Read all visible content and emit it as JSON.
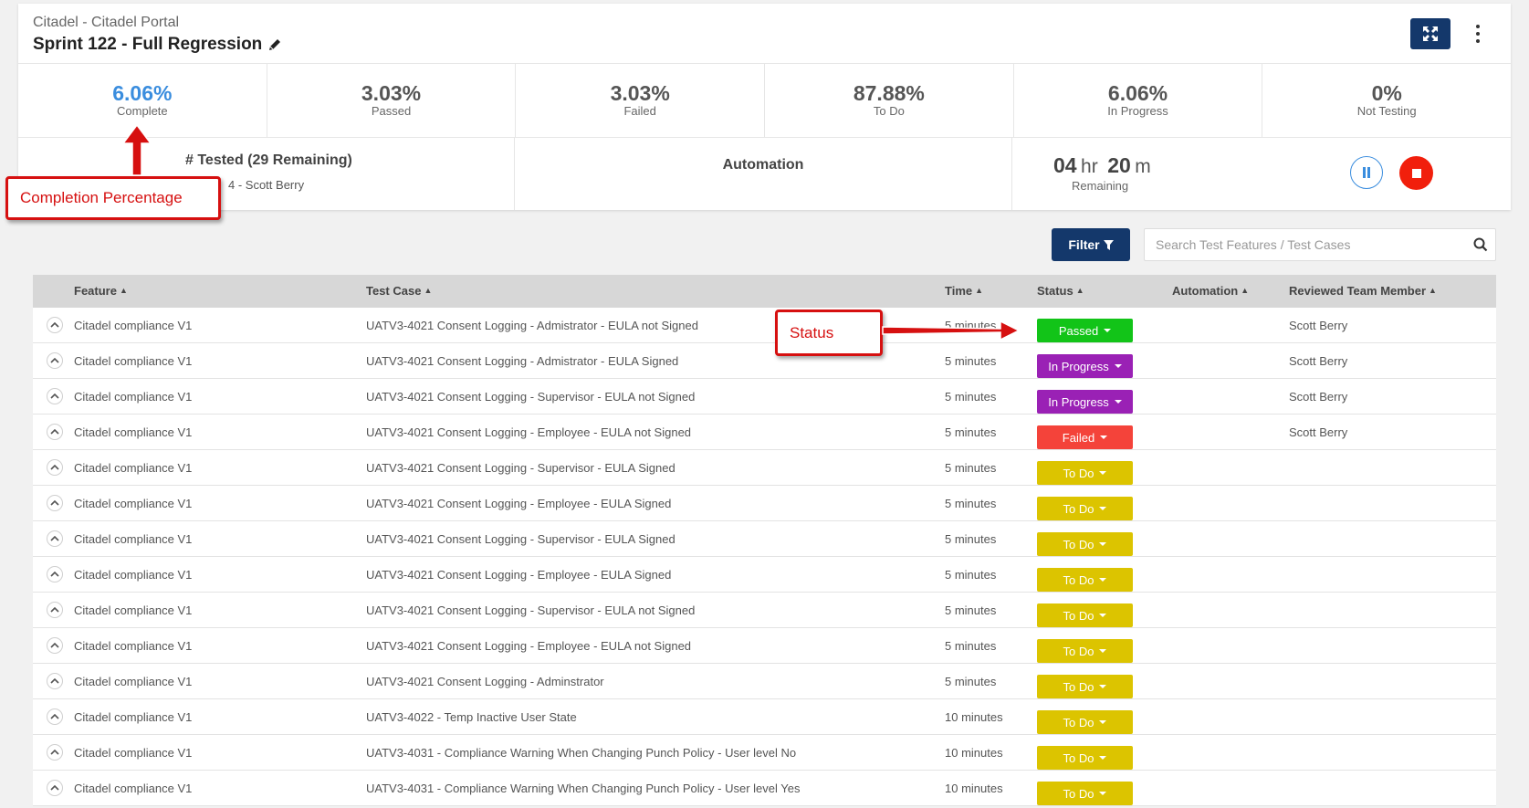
{
  "header": {
    "project": "Citadel - Citadel Portal",
    "sprint_title": "Sprint 122 - Full Regression"
  },
  "stats": [
    {
      "value": "6.06%",
      "label": "Complete"
    },
    {
      "value": "3.03%",
      "label": "Passed"
    },
    {
      "value": "3.03%",
      "label": "Failed"
    },
    {
      "value": "87.88%",
      "label": "To Do"
    },
    {
      "value": "6.06%",
      "label": "In Progress"
    },
    {
      "value": "0%",
      "label": "Not Testing"
    }
  ],
  "tested": {
    "title": "# Tested (29 Remaining)",
    "member": "4 - Scott Berry"
  },
  "automation": {
    "title": "Automation"
  },
  "timer": {
    "hours": "04",
    "hours_unit": "hr",
    "minutes": "20",
    "minutes_unit": "m",
    "label": "Remaining"
  },
  "toolbar": {
    "filter_label": "Filter",
    "search_placeholder": "Search Test Features / Test Cases"
  },
  "table": {
    "columns": [
      "Feature",
      "Test Case",
      "Time",
      "Status",
      "Automation",
      "Reviewed Team Member"
    ],
    "rows": [
      {
        "feature": "Citadel compliance V1",
        "test_case": "UATV3-4021 Consent Logging - Admistrator - EULA not Signed",
        "time": "5 minutes",
        "status": "Passed",
        "member": "Scott Berry"
      },
      {
        "feature": "Citadel compliance V1",
        "test_case": "UATV3-4021 Consent Logging - Admistrator - EULA Signed",
        "time": "5 minutes",
        "status": "In Progress",
        "member": "Scott Berry"
      },
      {
        "feature": "Citadel compliance V1",
        "test_case": "UATV3-4021 Consent Logging - Supervisor - EULA not Signed",
        "time": "5 minutes",
        "status": "In Progress",
        "member": "Scott Berry"
      },
      {
        "feature": "Citadel compliance V1",
        "test_case": "UATV3-4021 Consent Logging - Employee - EULA not Signed",
        "time": "5 minutes",
        "status": "Failed",
        "member": "Scott Berry"
      },
      {
        "feature": "Citadel compliance V1",
        "test_case": "UATV3-4021 Consent Logging - Supervisor - EULA Signed",
        "time": "5 minutes",
        "status": "To Do",
        "member": ""
      },
      {
        "feature": "Citadel compliance V1",
        "test_case": "UATV3-4021 Consent Logging - Employee - EULA Signed",
        "time": "5 minutes",
        "status": "To Do",
        "member": ""
      },
      {
        "feature": "Citadel compliance V1",
        "test_case": "UATV3-4021 Consent Logging - Supervisor - EULA Signed",
        "time": "5 minutes",
        "status": "To Do",
        "member": ""
      },
      {
        "feature": "Citadel compliance V1",
        "test_case": "UATV3-4021 Consent Logging - Employee - EULA Signed",
        "time": "5 minutes",
        "status": "To Do",
        "member": ""
      },
      {
        "feature": "Citadel compliance V1",
        "test_case": "UATV3-4021 Consent Logging - Supervisor - EULA not Signed",
        "time": "5 minutes",
        "status": "To Do",
        "member": ""
      },
      {
        "feature": "Citadel compliance V1",
        "test_case": "UATV3-4021 Consent Logging - Employee - EULA not Signed",
        "time": "5 minutes",
        "status": "To Do",
        "member": ""
      },
      {
        "feature": "Citadel compliance V1",
        "test_case": "UATV3-4021 Consent Logging - Adminstrator",
        "time": "5 minutes",
        "status": "To Do",
        "member": ""
      },
      {
        "feature": "Citadel compliance V1",
        "test_case": "UATV3-4022 - Temp Inactive User State",
        "time": "10 minutes",
        "status": "To Do",
        "member": ""
      },
      {
        "feature": "Citadel compliance V1",
        "test_case": "UATV3-4031 - Compliance Warning When Changing Punch Policy - User level No",
        "time": "10 minutes",
        "status": "To Do",
        "member": ""
      },
      {
        "feature": "Citadel compliance V1",
        "test_case": "UATV3-4031 - Compliance Warning When Changing Punch Policy - User level Yes",
        "time": "10 minutes",
        "status": "To Do",
        "member": ""
      }
    ]
  },
  "status_colors": {
    "Passed": "#12c418",
    "In Progress": "#9a21b5",
    "Failed": "#f4433a",
    "To Do": "#dcc400"
  },
  "callouts": {
    "completion": "Completion Percentage",
    "status": "Status"
  },
  "icons": {
    "edit": "pencil-icon",
    "expand": "expand-arrows-icon",
    "menu": "vertical-dots-icon",
    "pause": "pause-icon",
    "stop": "stop-icon",
    "filter": "funnel-icon",
    "search": "magnifier-icon",
    "row_toggle": "chevron-up-icon"
  }
}
